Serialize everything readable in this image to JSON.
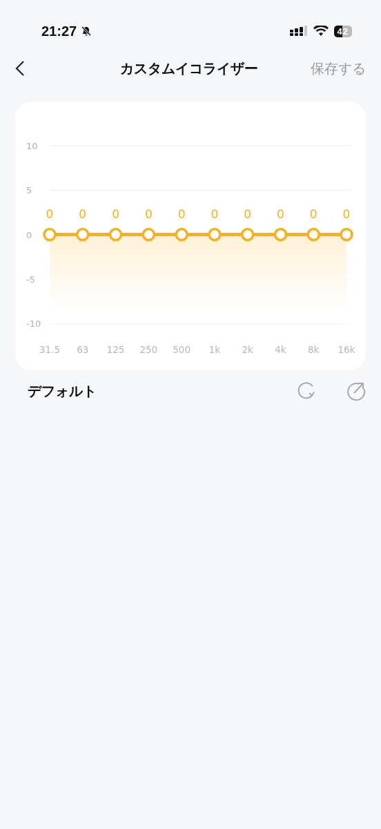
{
  "status_bar": {
    "time": "21:27",
    "battery": "42"
  },
  "header": {
    "title": "カスタムイコライザー",
    "save": "保存する"
  },
  "equalizer": {
    "chart_data": {
      "type": "line",
      "categories": [
        "31.5",
        "63",
        "125",
        "250",
        "500",
        "1k",
        "2k",
        "4k",
        "8k",
        "16k"
      ],
      "series": [
        {
          "color": "#f5b21c",
          "marker": "circle",
          "values": [
            0,
            0,
            0,
            0,
            0,
            0,
            0,
            0,
            0,
            0
          ]
        }
      ],
      "ylim": [
        -10,
        10
      ],
      "yticks": [
        -10,
        -5,
        0,
        5,
        10
      ],
      "data_labels": true
    }
  },
  "preset": {
    "name": "デフォルト"
  }
}
